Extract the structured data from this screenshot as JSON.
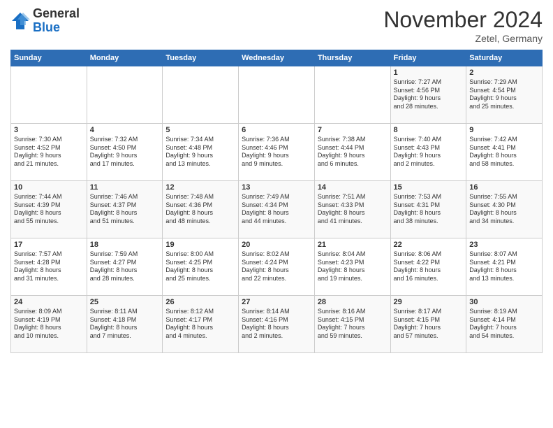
{
  "header": {
    "logo_general": "General",
    "logo_blue": "Blue",
    "month_title": "November 2024",
    "subtitle": "Zetel, Germany"
  },
  "days_of_week": [
    "Sunday",
    "Monday",
    "Tuesday",
    "Wednesday",
    "Thursday",
    "Friday",
    "Saturday"
  ],
  "weeks": [
    [
      {
        "day": "",
        "content": ""
      },
      {
        "day": "",
        "content": ""
      },
      {
        "day": "",
        "content": ""
      },
      {
        "day": "",
        "content": ""
      },
      {
        "day": "",
        "content": ""
      },
      {
        "day": "1",
        "content": "Sunrise: 7:27 AM\nSunset: 4:56 PM\nDaylight: 9 hours\nand 28 minutes."
      },
      {
        "day": "2",
        "content": "Sunrise: 7:29 AM\nSunset: 4:54 PM\nDaylight: 9 hours\nand 25 minutes."
      }
    ],
    [
      {
        "day": "3",
        "content": "Sunrise: 7:30 AM\nSunset: 4:52 PM\nDaylight: 9 hours\nand 21 minutes."
      },
      {
        "day": "4",
        "content": "Sunrise: 7:32 AM\nSunset: 4:50 PM\nDaylight: 9 hours\nand 17 minutes."
      },
      {
        "day": "5",
        "content": "Sunrise: 7:34 AM\nSunset: 4:48 PM\nDaylight: 9 hours\nand 13 minutes."
      },
      {
        "day": "6",
        "content": "Sunrise: 7:36 AM\nSunset: 4:46 PM\nDaylight: 9 hours\nand 9 minutes."
      },
      {
        "day": "7",
        "content": "Sunrise: 7:38 AM\nSunset: 4:44 PM\nDaylight: 9 hours\nand 6 minutes."
      },
      {
        "day": "8",
        "content": "Sunrise: 7:40 AM\nSunset: 4:43 PM\nDaylight: 9 hours\nand 2 minutes."
      },
      {
        "day": "9",
        "content": "Sunrise: 7:42 AM\nSunset: 4:41 PM\nDaylight: 8 hours\nand 58 minutes."
      }
    ],
    [
      {
        "day": "10",
        "content": "Sunrise: 7:44 AM\nSunset: 4:39 PM\nDaylight: 8 hours\nand 55 minutes."
      },
      {
        "day": "11",
        "content": "Sunrise: 7:46 AM\nSunset: 4:37 PM\nDaylight: 8 hours\nand 51 minutes."
      },
      {
        "day": "12",
        "content": "Sunrise: 7:48 AM\nSunset: 4:36 PM\nDaylight: 8 hours\nand 48 minutes."
      },
      {
        "day": "13",
        "content": "Sunrise: 7:49 AM\nSunset: 4:34 PM\nDaylight: 8 hours\nand 44 minutes."
      },
      {
        "day": "14",
        "content": "Sunrise: 7:51 AM\nSunset: 4:33 PM\nDaylight: 8 hours\nand 41 minutes."
      },
      {
        "day": "15",
        "content": "Sunrise: 7:53 AM\nSunset: 4:31 PM\nDaylight: 8 hours\nand 38 minutes."
      },
      {
        "day": "16",
        "content": "Sunrise: 7:55 AM\nSunset: 4:30 PM\nDaylight: 8 hours\nand 34 minutes."
      }
    ],
    [
      {
        "day": "17",
        "content": "Sunrise: 7:57 AM\nSunset: 4:28 PM\nDaylight: 8 hours\nand 31 minutes."
      },
      {
        "day": "18",
        "content": "Sunrise: 7:59 AM\nSunset: 4:27 PM\nDaylight: 8 hours\nand 28 minutes."
      },
      {
        "day": "19",
        "content": "Sunrise: 8:00 AM\nSunset: 4:25 PM\nDaylight: 8 hours\nand 25 minutes."
      },
      {
        "day": "20",
        "content": "Sunrise: 8:02 AM\nSunset: 4:24 PM\nDaylight: 8 hours\nand 22 minutes."
      },
      {
        "day": "21",
        "content": "Sunrise: 8:04 AM\nSunset: 4:23 PM\nDaylight: 8 hours\nand 19 minutes."
      },
      {
        "day": "22",
        "content": "Sunrise: 8:06 AM\nSunset: 4:22 PM\nDaylight: 8 hours\nand 16 minutes."
      },
      {
        "day": "23",
        "content": "Sunrise: 8:07 AM\nSunset: 4:21 PM\nDaylight: 8 hours\nand 13 minutes."
      }
    ],
    [
      {
        "day": "24",
        "content": "Sunrise: 8:09 AM\nSunset: 4:19 PM\nDaylight: 8 hours\nand 10 minutes."
      },
      {
        "day": "25",
        "content": "Sunrise: 8:11 AM\nSunset: 4:18 PM\nDaylight: 8 hours\nand 7 minutes."
      },
      {
        "day": "26",
        "content": "Sunrise: 8:12 AM\nSunset: 4:17 PM\nDaylight: 8 hours\nand 4 minutes."
      },
      {
        "day": "27",
        "content": "Sunrise: 8:14 AM\nSunset: 4:16 PM\nDaylight: 8 hours\nand 2 minutes."
      },
      {
        "day": "28",
        "content": "Sunrise: 8:16 AM\nSunset: 4:15 PM\nDaylight: 7 hours\nand 59 minutes."
      },
      {
        "day": "29",
        "content": "Sunrise: 8:17 AM\nSunset: 4:15 PM\nDaylight: 7 hours\nand 57 minutes."
      },
      {
        "day": "30",
        "content": "Sunrise: 8:19 AM\nSunset: 4:14 PM\nDaylight: 7 hours\nand 54 minutes."
      }
    ]
  ]
}
